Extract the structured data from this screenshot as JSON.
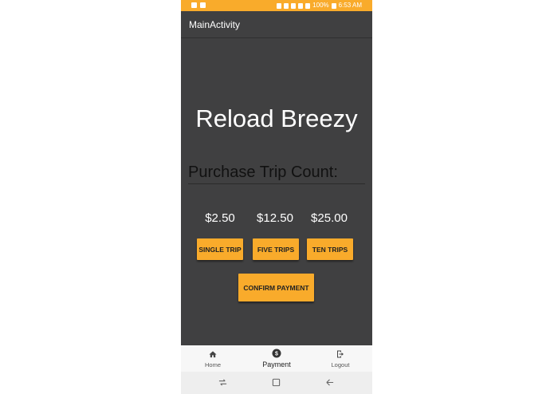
{
  "status_bar": {
    "battery": "100%",
    "time": "6:53 AM",
    "color": "#f9ab2b"
  },
  "app_bar": {
    "title": "MainActivity"
  },
  "main": {
    "heading": "Reload Breezy",
    "trip_count_text": "Purchase Trip Count:",
    "prices": [
      "$2.50",
      "$12.50",
      "$25.00"
    ],
    "buttons": {
      "single_trip": "SINGLE TRIP",
      "five_trips": "FIVE TRIPS",
      "ten_trips": "TEN TRIPS",
      "confirm_payment": "CONFIRM PAYMENT"
    },
    "background_color": "#404041",
    "accent_color": "#f9ab2b"
  },
  "bottom_nav": {
    "items": [
      {
        "label": "Home",
        "icon": "home-icon"
      },
      {
        "label": "Payment",
        "icon": "dollar-icon"
      },
      {
        "label": "Logout",
        "icon": "logout-icon"
      }
    ],
    "active": "Payment"
  },
  "system_nav": {
    "buttons": [
      "recents-icon",
      "home-square-icon",
      "back-icon"
    ]
  }
}
